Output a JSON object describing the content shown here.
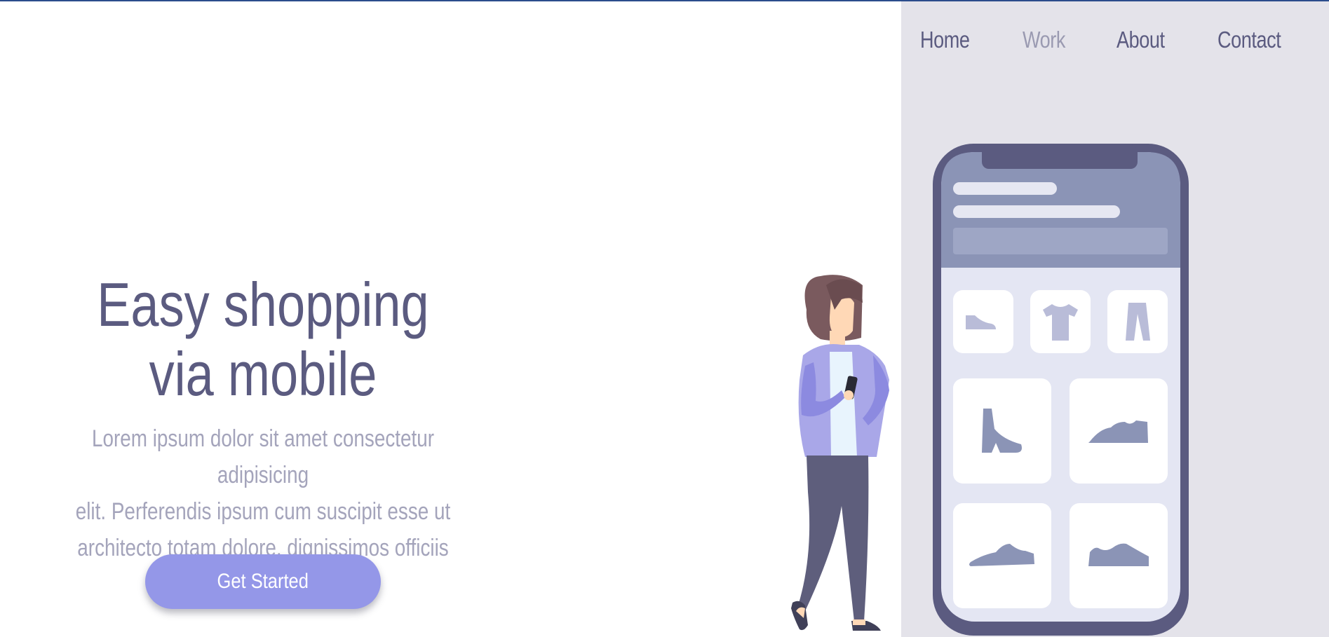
{
  "nav": {
    "items": [
      {
        "label": "Home",
        "active": false
      },
      {
        "label": "Work",
        "active": true
      },
      {
        "label": "About",
        "active": false
      },
      {
        "label": "Contact",
        "active": false
      }
    ]
  },
  "hero": {
    "title_line1": "Easy shopping",
    "title_line2": "via mobile",
    "text_line1": "Lorem ipsum dolor sit amet consectetur adipisicing",
    "text_line2": "elit. Perferendis ipsum cum suscipit esse ut",
    "text_line3": "architecto totam dolore, dignissimos officiis sunt.",
    "cta_label": "Get Started"
  },
  "colors": {
    "primary_text": "#5b5b80",
    "muted_text": "#a4a4bb",
    "accent": "#9497e8",
    "panel_bg": "#e4e3ea",
    "phone_frame": "#5b5b80"
  },
  "illustration": {
    "phone_icons": [
      "flat-shoe-icon",
      "tshirt-icon",
      "pants-icon",
      "ankle-boot-icon",
      "sneaker-icon",
      "loafer-icon",
      "slip-on-shoe-icon"
    ]
  }
}
